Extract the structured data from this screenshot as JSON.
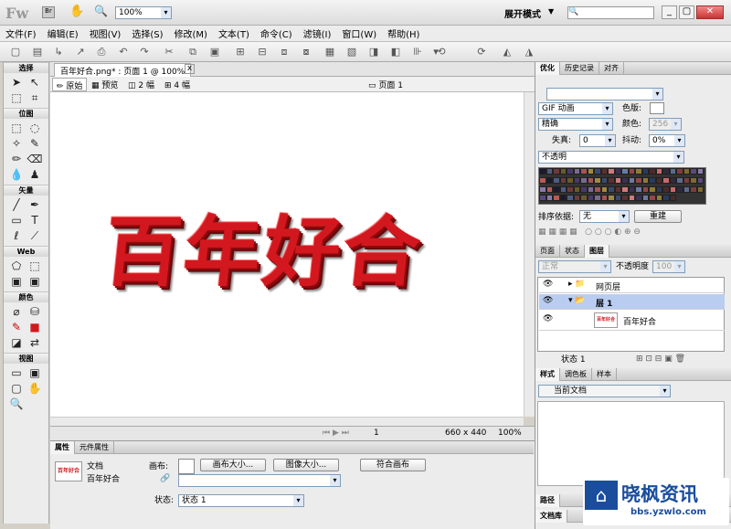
{
  "app": {
    "logo": "Fw",
    "zoom": "100%",
    "mode": "展开模式"
  },
  "menu": [
    "文件(F)",
    "编辑(E)",
    "视图(V)",
    "选择(S)",
    "修改(M)",
    "文本(T)",
    "命令(C)",
    "滤镜(I)",
    "窗口(W)",
    "帮助(H)"
  ],
  "doc": {
    "tab": "百年好合.png* : 页面 1 @ 100%",
    "views": {
      "original": "原始",
      "preview": "预览",
      "two": "2 幅",
      "four": "4 幅"
    },
    "page": "页面 1",
    "text": "百年好合",
    "size": "660 x 440",
    "zoom": "100%",
    "frame": "1"
  },
  "tools": {
    "select": "选择",
    "bitmap": "位图",
    "vector": "矢量",
    "web": "Web",
    "colors": "颜色",
    "view": "视图"
  },
  "props": {
    "tabs": [
      "属性",
      "元件属性"
    ],
    "type": "文档",
    "name": "百年好合",
    "canvas_label": "画布:",
    "canvas_size": "画布大小...",
    "image_size": "图像大小...",
    "fit": "符合画布",
    "state_label": "状态:",
    "state": "状态 1"
  },
  "optimize": {
    "tabs": [
      "优化",
      "历史记录",
      "对齐"
    ],
    "format": "GIF 动画",
    "palette": "精确",
    "loss_label": "失真:",
    "loss": "0",
    "dither_label": "抖动:",
    "dither": "0%",
    "transparency": "不透明",
    "colors_label": "色版:",
    "count_label": "颜色:",
    "count": "256",
    "sort_label": "排序依据:",
    "sort": "无",
    "rebuild": "重建"
  },
  "layers": {
    "tabs": [
      "页面",
      "状态",
      "图层"
    ],
    "blend": "正常",
    "opacity_label": "不透明度",
    "opacity": "100",
    "rows": [
      "网页层",
      "层 1",
      "百年好合"
    ],
    "status": "状态 1"
  },
  "styles": {
    "tabs": [
      "样式",
      "调色板",
      "样本"
    ],
    "doc": "当前文档"
  },
  "path": {
    "tabs": [
      "路径",
      "文档库"
    ]
  },
  "watermark": {
    "brand": "晓枫资讯",
    "url": "bbs.yzwlo.com"
  },
  "colors": {
    "accent": "#d2181e",
    "selection": "#b9cdf0"
  }
}
